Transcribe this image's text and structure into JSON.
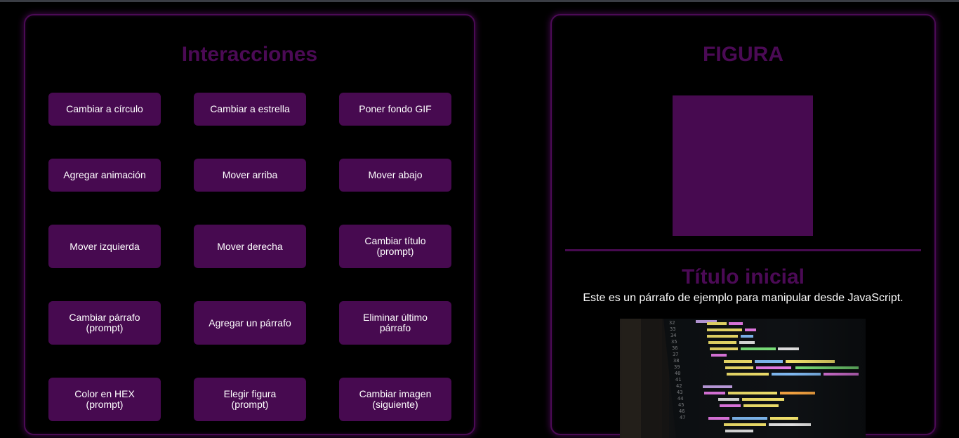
{
  "interactions": {
    "title": "Interacciones",
    "buttons": [
      {
        "label": "Cambiar a círculo"
      },
      {
        "label": "Cambiar a estrella"
      },
      {
        "label": "Poner fondo GIF"
      },
      {
        "label": "Agregar animación"
      },
      {
        "label": "Mover arriba"
      },
      {
        "label": "Mover abajo"
      },
      {
        "label": "Mover izquierda"
      },
      {
        "label": "Mover derecha"
      },
      {
        "label": "Cambiar título\n(prompt)"
      },
      {
        "label": "Cambiar párrafo\n(prompt)"
      },
      {
        "label": "Agregar un párrafo"
      },
      {
        "label": "Eliminar último\npárrafo"
      },
      {
        "label": "Color en HEX\n(prompt)"
      },
      {
        "label": "Elegir figura\n(prompt)"
      },
      {
        "label": "Cambiar imagen\n(siguiente)"
      }
    ]
  },
  "figure_panel": {
    "title": "FIGURA",
    "shape_color": "#470a50"
  },
  "content": {
    "title": "Título inicial",
    "paragraph": "Este es un párrafo de ejemplo para manipular desde JavaScript.",
    "image_alt": "code-screenshot"
  },
  "theme": {
    "accent": "#4b0a55",
    "button_bg": "#470a50",
    "background": "#000000",
    "text": "#ffffff"
  }
}
